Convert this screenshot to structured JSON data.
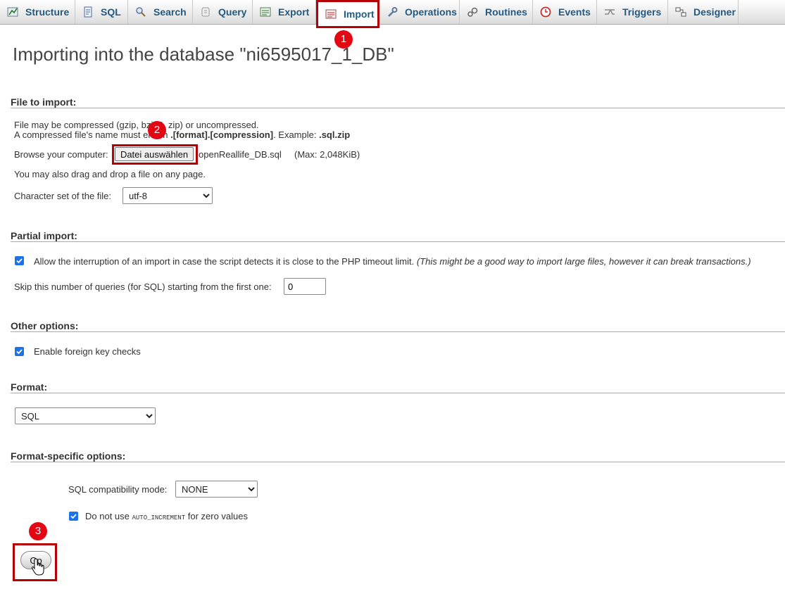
{
  "tabs": [
    {
      "label": "Structure",
      "icon": "structure-icon"
    },
    {
      "label": "SQL",
      "icon": "sql-icon"
    },
    {
      "label": "Search",
      "icon": "search-icon"
    },
    {
      "label": "Query",
      "icon": "query-icon"
    },
    {
      "label": "Export",
      "icon": "export-icon"
    },
    {
      "label": "Import",
      "icon": "import-icon",
      "active": true
    },
    {
      "label": "Operations",
      "icon": "wrench-icon"
    },
    {
      "label": "Routines",
      "icon": "routines-icon"
    },
    {
      "label": "Events",
      "icon": "clock-icon"
    },
    {
      "label": "Triggers",
      "icon": "triggers-icon"
    },
    {
      "label": "Designer",
      "icon": "designer-icon"
    }
  ],
  "annotations": [
    "1",
    "2",
    "3"
  ],
  "title": "Importing into the database \"ni6595017_1_DB\"",
  "file_section": {
    "legend": "File to import:",
    "compress_line": "File may be compressed (gzip, bzip2, zip) or uncompressed.",
    "name_prefix": "A compressed file's name must end in ",
    "name_format": ".[format].[compression]",
    "example_label": ". Example: ",
    "example_value": ".sql.zip",
    "browse_label": "Browse your computer:",
    "file_button": "Datei auswählen",
    "file_name": "openReallife_DB.sql",
    "max_size": "(Max: 2,048KiB)",
    "drag_hint": "You may also drag and drop a file on any page.",
    "charset_label": "Character set of the file:",
    "charset_value": "utf-8"
  },
  "partial_section": {
    "legend": "Partial import:",
    "allow_interrupt": "Allow the interruption of an import in case the script detects it is close to the PHP timeout limit.",
    "allow_interrupt_note": "(This might be a good way to import large files, however it can break transactions.)",
    "allow_interrupt_checked": true,
    "skip_label": "Skip this number of queries (for SQL) starting from the first one:",
    "skip_value": "0"
  },
  "other_section": {
    "legend": "Other options:",
    "foreign_keys": "Enable foreign key checks",
    "foreign_keys_checked": true
  },
  "format_section": {
    "legend": "Format:",
    "format_value": "SQL"
  },
  "format_options": {
    "legend": "Format-specific options:",
    "compat_label": "SQL compatibility mode:",
    "compat_value": "NONE",
    "no_auto_prefix": "Do not use ",
    "no_auto_code": "AUTO_INCREMENT",
    "no_auto_suffix": " for zero values",
    "no_auto_checked": true
  },
  "go_button": "Go",
  "colors": {
    "tab_text": "#235a81",
    "highlight": "#b50006",
    "badge": "#e30613",
    "checkbox": "#1a73e8"
  }
}
